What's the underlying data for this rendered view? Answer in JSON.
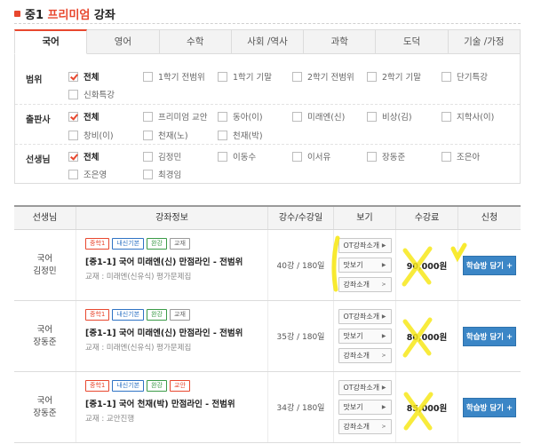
{
  "header": {
    "title_pre": "중1 ",
    "title_highlight": "프리미엄",
    "title_post": " 강좌"
  },
  "tabs": [
    {
      "label": "국어",
      "active": true
    },
    {
      "label": "영어",
      "active": false
    },
    {
      "label": "수학",
      "active": false
    },
    {
      "label": "사회 /역사",
      "active": false
    },
    {
      "label": "과학",
      "active": false
    },
    {
      "label": "도덕",
      "active": false
    },
    {
      "label": "기술 /가정",
      "active": false
    }
  ],
  "filters": {
    "scope": {
      "label": "범위",
      "options": [
        {
          "label": "전체",
          "checked": true
        },
        {
          "label": "1학기 전범위",
          "checked": false
        },
        {
          "label": "1학기 기말",
          "checked": false
        },
        {
          "label": "2학기 전범위",
          "checked": false
        },
        {
          "label": "2학기 기말",
          "checked": false
        },
        {
          "label": "단기특강",
          "checked": false
        },
        {
          "label": "신화특강",
          "checked": false
        }
      ]
    },
    "publisher": {
      "label": "출판사",
      "options": [
        {
          "label": "전체",
          "checked": true
        },
        {
          "label": "프리미엄 교안",
          "checked": false
        },
        {
          "label": "동아(이)",
          "checked": false
        },
        {
          "label": "미래엔(신)",
          "checked": false
        },
        {
          "label": "비상(김)",
          "checked": false
        },
        {
          "label": "지학사(이)",
          "checked": false
        },
        {
          "label": "창비(이)",
          "checked": false
        },
        {
          "label": "천재(노)",
          "checked": false
        },
        {
          "label": "천재(박)",
          "checked": false
        }
      ]
    },
    "teacher": {
      "label": "선생님",
      "options": [
        {
          "label": "전체",
          "checked": true
        },
        {
          "label": "김정민",
          "checked": false
        },
        {
          "label": "이동수",
          "checked": false
        },
        {
          "label": "이서유",
          "checked": false
        },
        {
          "label": "장동준",
          "checked": false
        },
        {
          "label": "조은아",
          "checked": false
        },
        {
          "label": "조은영",
          "checked": false
        },
        {
          "label": "최경임",
          "checked": false
        }
      ]
    }
  },
  "table": {
    "headers": [
      "선생님",
      "강좌정보",
      "강수/수강일",
      "보기",
      "수강료",
      "신청"
    ],
    "rows": [
      {
        "subject": "국어",
        "teacher": "김정민",
        "badges": [
          "중학1",
          "내신기본",
          "완강",
          "교재"
        ],
        "title": "[중1-1] 국어 미래엔(신) 만점라인 - 전범위",
        "book": "교재 : 미래엔(신유식) 평가문제집",
        "lectures": "40강 / 180일",
        "btn_ot": "OT강좌소개",
        "btn_preview": "맛보기",
        "btn_intro": "강좌소개",
        "price": "90,000원",
        "apply": "학습방 담기 +"
      },
      {
        "subject": "국어",
        "teacher": "장동준",
        "badges": [
          "중학1",
          "내신기본",
          "완강",
          "교재"
        ],
        "title": "[중1-1] 국어 미래엔(신) 만점라인 - 전범위",
        "book": "교재 : 미래엔(신유식) 평가문제집",
        "lectures": "35강 / 180일",
        "btn_ot": "OT강좌소개",
        "btn_preview": "맛보기",
        "btn_intro": "강좌소개",
        "price": "80,000원",
        "apply": "학습방 담기 +"
      },
      {
        "subject": "국어",
        "teacher": "장동준",
        "badges": [
          "중학1",
          "내신기본",
          "완강",
          "교안"
        ],
        "title": "[중1-1] 국어 천재(박) 만점라인 - 전범위",
        "book": "교재 : 교안진행",
        "lectures": "34강 / 180일",
        "btn_ot": "OT강좌소개",
        "btn_preview": "맛보기",
        "btn_intro": "강좌소개",
        "price": "85,000원",
        "apply": "학습방 담기 +"
      }
    ]
  },
  "colors": {
    "accent": "#e8472e",
    "apply_button": "#3b86c6",
    "highlighter": "#f7e81a"
  }
}
